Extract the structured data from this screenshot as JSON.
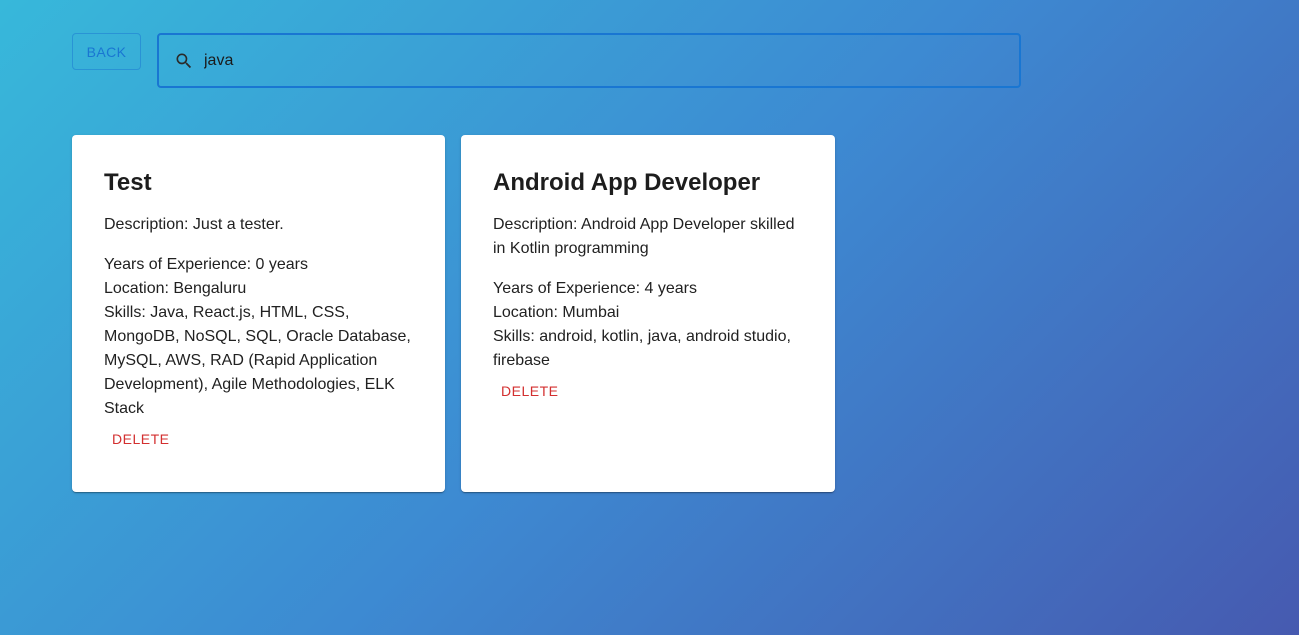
{
  "header": {
    "back_label": "BACK",
    "search": {
      "value": "java",
      "icon": "search-icon"
    }
  },
  "colors": {
    "accent": "#1976d2",
    "danger": "#d32f2f"
  },
  "results": [
    {
      "title": "Test",
      "description": "Description: Just a tester.",
      "experience": "Years of Experience: 0 years",
      "location": "Location: Bengaluru",
      "skills": "Skills: Java, React.js, HTML, CSS, MongoDB, NoSQL, SQL, Oracle Database, MySQL, AWS, RAD (Rapid Application Development), Agile Methodologies, ELK Stack",
      "delete_label": "DELETE"
    },
    {
      "title": "Android App Developer",
      "description": "Description: Android App Developer skilled in Kotlin programming",
      "experience": "Years of Experience: 4 years",
      "location": "Location: Mumbai",
      "skills": "Skills: android, kotlin, java, android studio, firebase",
      "delete_label": "DELETE"
    }
  ]
}
